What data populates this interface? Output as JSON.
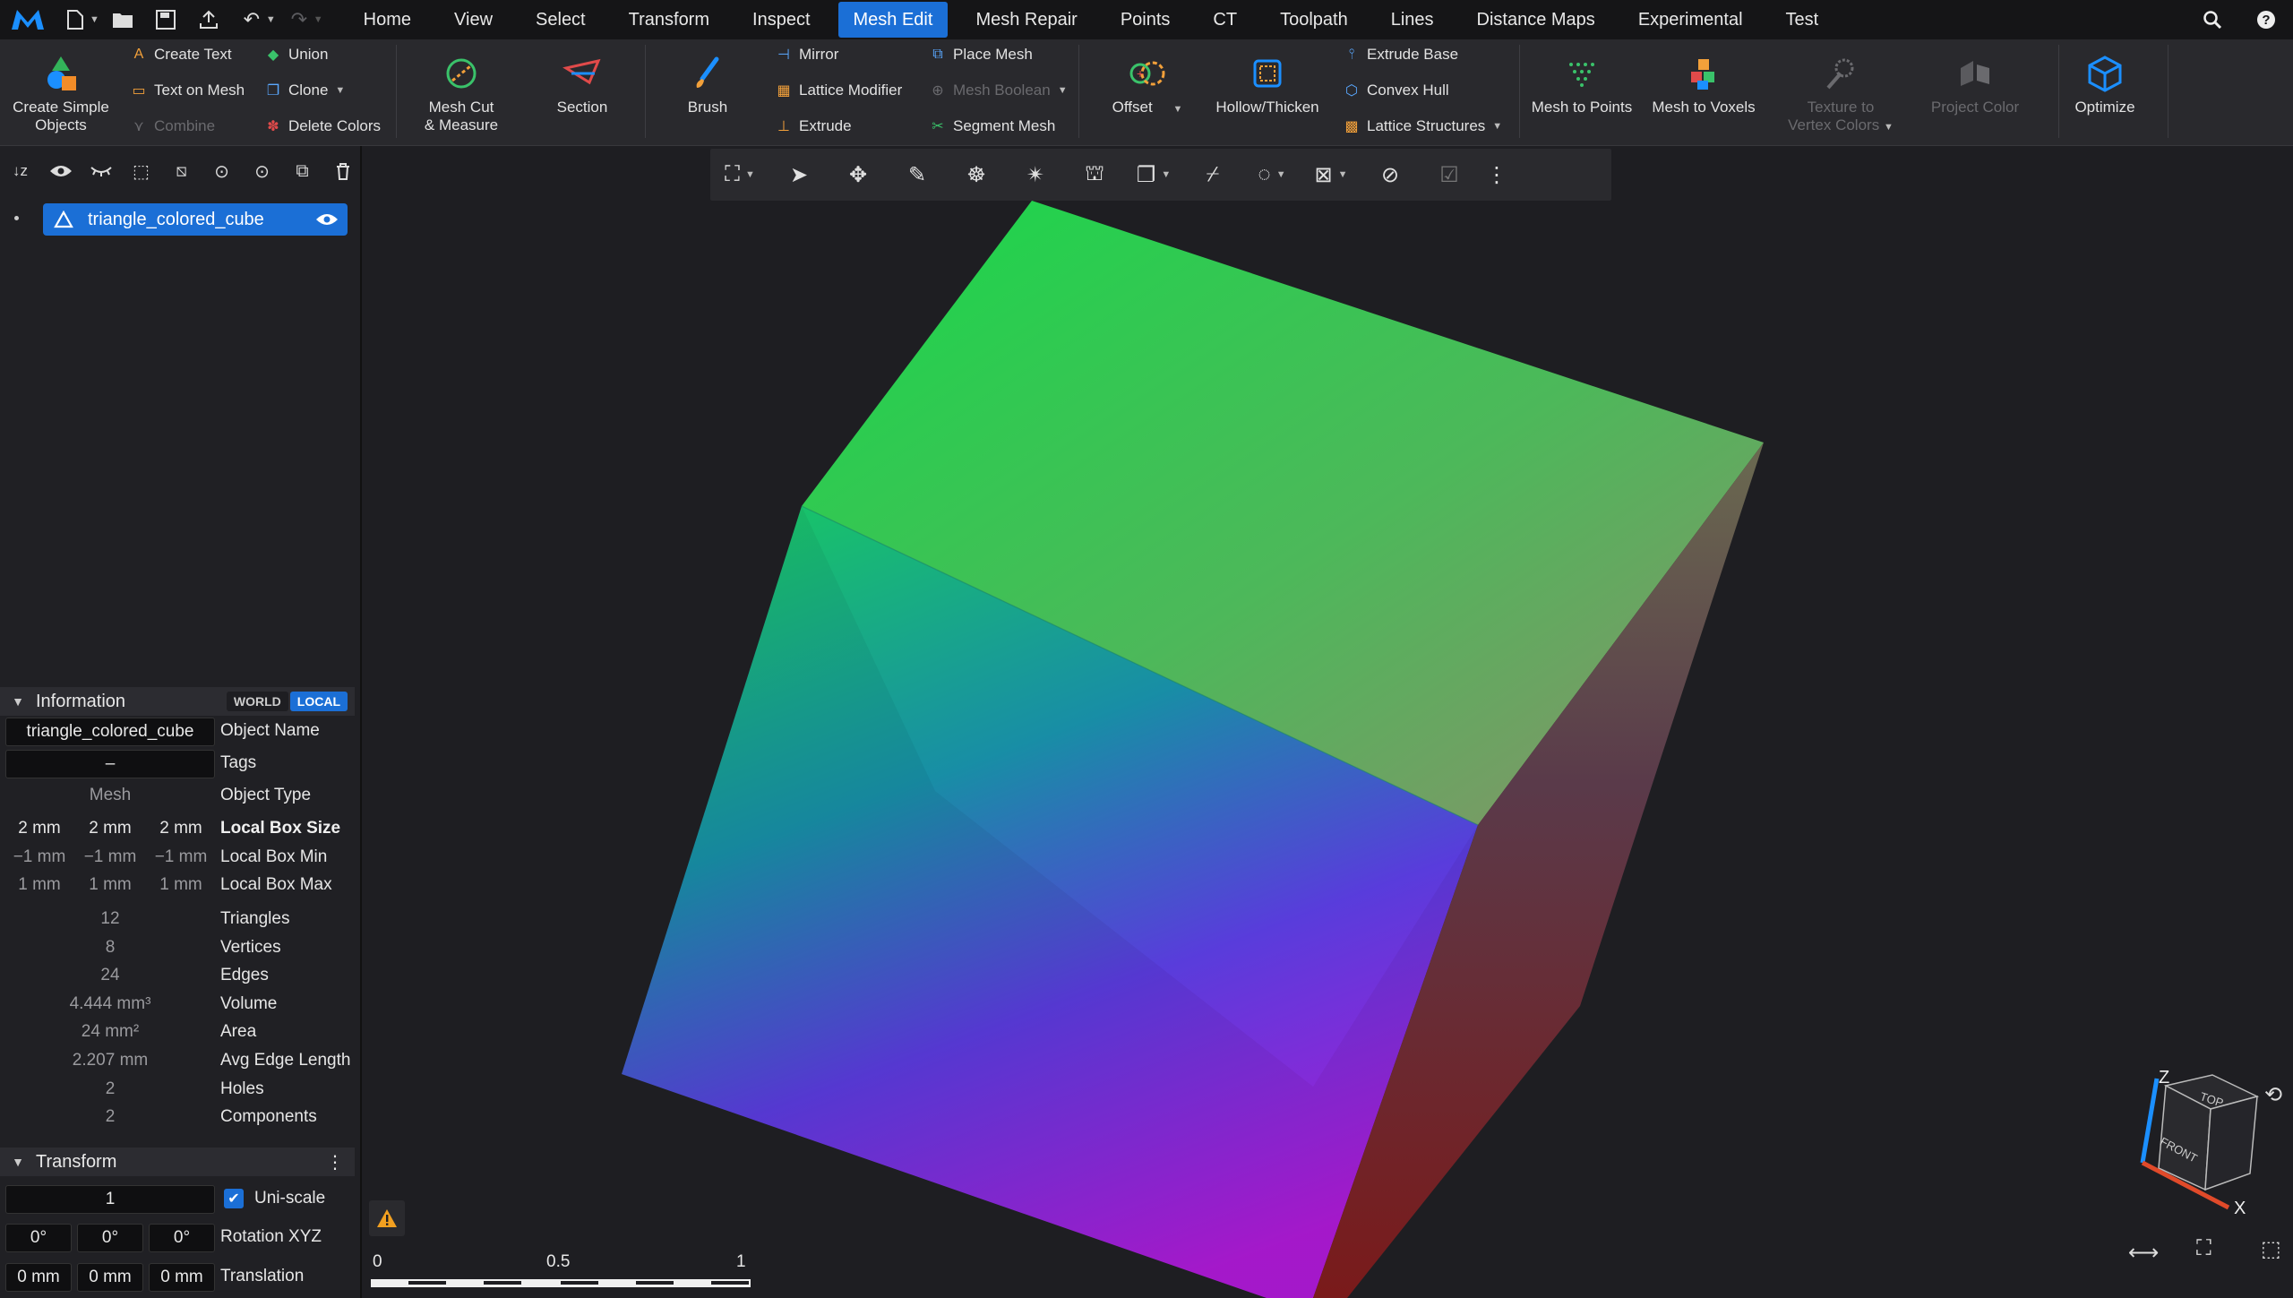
{
  "menu": {
    "tabs": [
      "Home",
      "View",
      "Select",
      "Transform",
      "Inspect",
      "Mesh Edit",
      "Mesh Repair",
      "Points",
      "CT",
      "Toolpath",
      "Lines",
      "Distance Maps",
      "Experimental",
      "Test"
    ],
    "active_tab": "Mesh Edit"
  },
  "ribbon": {
    "create_simple_objects": "Create Simple Objects",
    "create_text": "Create Text",
    "text_on_mesh": "Text on Mesh",
    "combine": "Combine",
    "union": "Union",
    "clone": "Clone",
    "delete_colors": "Delete Colors",
    "mesh_cut_measure_1": "Mesh Cut",
    "mesh_cut_measure_2": "& Measure",
    "section": "Section",
    "brush": "Brush",
    "mirror": "Mirror",
    "lattice_modifier": "Lattice Modifier",
    "extrude": "Extrude",
    "place_mesh": "Place Mesh",
    "mesh_boolean": "Mesh Boolean",
    "segment_mesh": "Segment Mesh",
    "offset": "Offset",
    "hollow_thicken": "Hollow/Thicken",
    "extrude_base": "Extrude Base",
    "convex_hull": "Convex Hull",
    "lattice_structures": "Lattice Structures",
    "mesh_to_points": "Mesh to Points",
    "mesh_to_voxels": "Mesh to Voxels",
    "texture_to_vertex_colors_1": "Texture to",
    "texture_to_vertex_colors_2": "Vertex Colors",
    "project_color": "Project Color",
    "optimize": "Optimize"
  },
  "scene": {
    "object_name": "triangle_colored_cube"
  },
  "information": {
    "title": "Information",
    "world": "WORLD",
    "local": "LOCAL",
    "object_name_value": "triangle_colored_cube",
    "object_name_label": "Object Name",
    "tags_value": "–",
    "tags_label": "Tags",
    "object_type_value": "Mesh",
    "object_type_label": "Object Type",
    "box_size": [
      "2 mm",
      "2 mm",
      "2 mm"
    ],
    "box_size_label": "Local Box Size",
    "box_min": [
      "−1 mm",
      "−1 mm",
      "−1 mm"
    ],
    "box_min_label": "Local Box Min",
    "box_max": [
      "1 mm",
      "1 mm",
      "1 mm"
    ],
    "box_max_label": "Local Box Max",
    "stats": [
      {
        "value": "12",
        "label": "Triangles"
      },
      {
        "value": "8",
        "label": "Vertices"
      },
      {
        "value": "24",
        "label": "Edges"
      },
      {
        "value": "4.444 mm³",
        "label": "Volume"
      },
      {
        "value": "24 mm²",
        "label": "Area"
      },
      {
        "value": "2.207 mm",
        "label": "Avg Edge Length"
      },
      {
        "value": "2",
        "label": "Holes"
      },
      {
        "value": "2",
        "label": "Components"
      }
    ]
  },
  "transform": {
    "title": "Transform",
    "scale_value": "1",
    "uniscale_label": "Uni-scale",
    "rotation": [
      "0°",
      "0°",
      "0°"
    ],
    "rotation_label": "Rotation XYZ",
    "translation": [
      "0 mm",
      "0 mm",
      "0 mm"
    ],
    "translation_label": "Translation"
  },
  "viewport": {
    "scale_labels": [
      "0",
      "0.5",
      "1"
    ],
    "axis_z": "Z",
    "axis_x": "X",
    "cube_top": "TOP",
    "cube_front": "FRONT"
  },
  "colors": {
    "accent": "#1b6fd6",
    "background": "#1e1e22",
    "panel": "#202024",
    "ribbon": "#29292d"
  }
}
